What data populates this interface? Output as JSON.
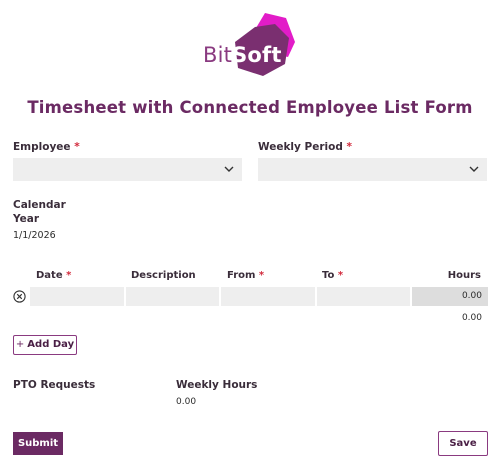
{
  "logo": {
    "text_bit": "Bit",
    "text_soft": "Soft"
  },
  "title": "Timesheet with Connected Employee List Form",
  "employee": {
    "label": "Employee",
    "required": "*",
    "value": ""
  },
  "weekly_period": {
    "label": "Weekly Period",
    "required": "*",
    "value": ""
  },
  "calendar_year": {
    "label_line1": "Calendar",
    "label_line2": "Year",
    "value": "1/1/2026"
  },
  "table": {
    "headers": {
      "date": "Date",
      "date_req": "*",
      "description": "Description",
      "from": "From",
      "from_req": "*",
      "to": "To",
      "to_req": "*",
      "hours": "Hours"
    },
    "row": {
      "date": "",
      "description": "",
      "from": "",
      "to": "",
      "hours": "0.00"
    },
    "total": "0.00"
  },
  "add_day": {
    "icon": "plus-icon",
    "label": "Add Day"
  },
  "pto": {
    "label": "PTO Requests"
  },
  "weekly_hours": {
    "label": "Weekly Hours",
    "value": "0.00"
  },
  "submit_label": "Submit",
  "save_label": "Save",
  "colors": {
    "brand": "#6b2a63",
    "logo_magenta": "#e21cc8",
    "logo_purple": "#7a2f70",
    "required": "#d22a3c",
    "field_bg": "#eeeeee"
  }
}
